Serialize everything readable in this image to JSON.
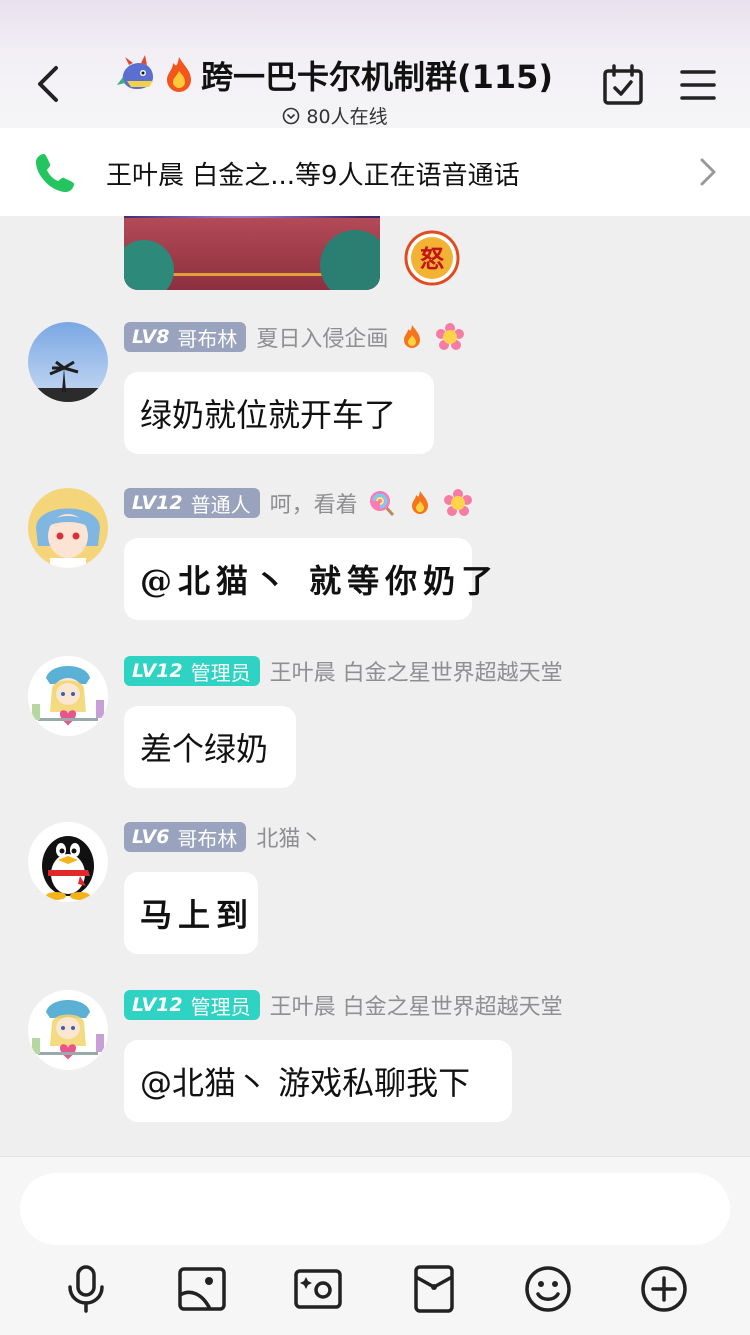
{
  "header": {
    "title": "跨一巴卡尔机制群(115)",
    "online": "80人在线",
    "icons": [
      "back-icon",
      "dragon-icon",
      "fire-icon",
      "calendar-check-icon",
      "menu-icon"
    ]
  },
  "voice_banner": {
    "text": "王叶晨 白金之...等9人正在语音通话",
    "icons": [
      "phone-icon",
      "chevron-right-icon"
    ]
  },
  "messages": [
    {
      "level": "LV8",
      "role": "哥布林",
      "nick": "夏日入侵企画",
      "text": "绿奶就位就开车了",
      "badge_color": "#9aa3bd",
      "icons": [
        "fire-icon",
        "flower-icon"
      ]
    },
    {
      "level": "LV12",
      "role": "普通人",
      "nick": "呵，看着",
      "text": "@北猫丶 就等你奶了",
      "badge_color": "#9aa3bd",
      "icons": [
        "lollipop-icon",
        "fire-icon",
        "flower-icon"
      ]
    },
    {
      "level": "LV12",
      "role": "管理员",
      "nick": "王叶晨 白金之星世界超越天堂",
      "text": "差个绿奶",
      "badge_color": "#2fd3c4"
    },
    {
      "level": "LV6",
      "role": "哥布林",
      "nick": "北猫丶",
      "text": "马上到",
      "badge_color": "#9aa3bd"
    },
    {
      "level": "LV12",
      "role": "管理员",
      "nick": "王叶晨 白金之星世界超越天堂",
      "text": "@北猫丶 游戏私聊我下",
      "badge_color": "#2fd3c4"
    }
  ],
  "anger_badge": "怒",
  "input": {
    "placeholder": ""
  },
  "toolbar": [
    "microphone-icon",
    "image-icon",
    "camera-icon",
    "red-packet-icon",
    "smiley-icon",
    "plus-icon"
  ]
}
